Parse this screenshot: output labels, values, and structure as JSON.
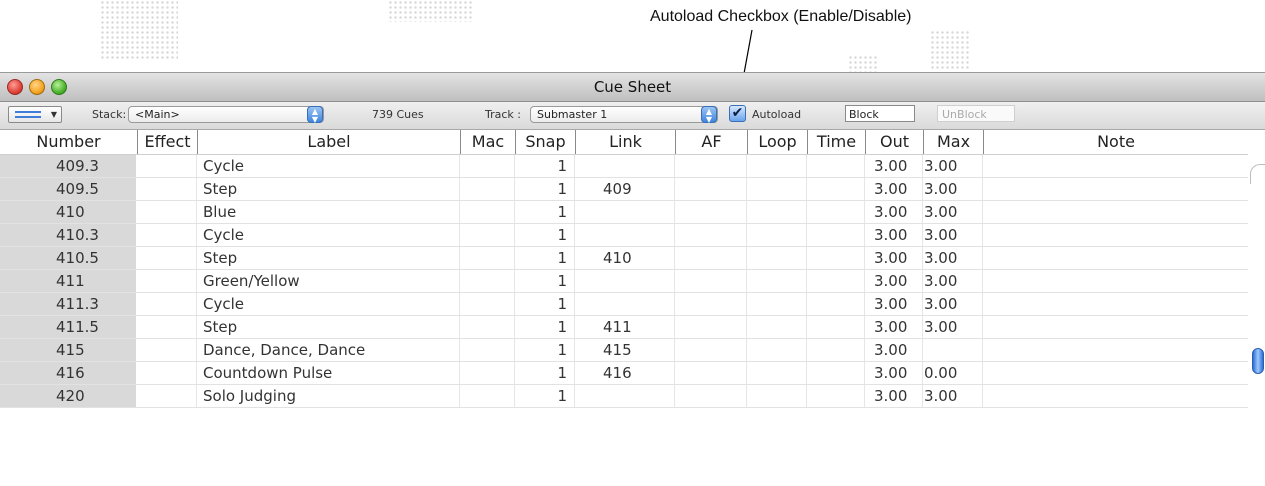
{
  "annotation": {
    "text": "Autoload Checkbox (Enable/Disable)"
  },
  "window": {
    "title": "Cue Sheet"
  },
  "toolbar": {
    "stack_label": "Stack:",
    "stack_value": "<Main>",
    "cue_count": "739 Cues",
    "track_label": "Track :",
    "track_value": "Submaster 1",
    "autoload_checked": true,
    "autoload_label": "Autoload",
    "block_label": "Block",
    "unblock_label": "UnBlock"
  },
  "table": {
    "columns": [
      "Number",
      "Effect",
      "Label",
      "Mac",
      "Snap",
      "Link",
      "AF",
      "Loop",
      "Time",
      "Out",
      "Max",
      "Note"
    ],
    "rows": [
      {
        "number": "409.3",
        "effect": "",
        "label": "Cycle",
        "mac": "",
        "snap": "1",
        "link": "",
        "af": "",
        "loop": "",
        "time": "",
        "out": "3.00",
        "max": "3.00",
        "note": ""
      },
      {
        "number": "409.5",
        "effect": "",
        "label": "Step",
        "mac": "",
        "snap": "1",
        "link": "409",
        "af": "",
        "loop": "",
        "time": "",
        "out": "3.00",
        "max": "3.00",
        "note": ""
      },
      {
        "number": "410",
        "effect": "",
        "label": "Blue",
        "mac": "",
        "snap": "1",
        "link": "",
        "af": "",
        "loop": "",
        "time": "",
        "out": "3.00",
        "max": "3.00",
        "note": ""
      },
      {
        "number": "410.3",
        "effect": "",
        "label": "Cycle",
        "mac": "",
        "snap": "1",
        "link": "",
        "af": "",
        "loop": "",
        "time": "",
        "out": "3.00",
        "max": "3.00",
        "note": ""
      },
      {
        "number": "410.5",
        "effect": "",
        "label": "Step",
        "mac": "",
        "snap": "1",
        "link": "410",
        "af": "",
        "loop": "",
        "time": "",
        "out": "3.00",
        "max": "3.00",
        "note": ""
      },
      {
        "number": "411",
        "effect": "",
        "label": "Green/Yellow",
        "mac": "",
        "snap": "1",
        "link": "",
        "af": "",
        "loop": "",
        "time": "",
        "out": "3.00",
        "max": "3.00",
        "note": ""
      },
      {
        "number": "411.3",
        "effect": "",
        "label": "Cycle",
        "mac": "",
        "snap": "1",
        "link": "",
        "af": "",
        "loop": "",
        "time": "",
        "out": "3.00",
        "max": "3.00",
        "note": ""
      },
      {
        "number": "411.5",
        "effect": "",
        "label": "Step",
        "mac": "",
        "snap": "1",
        "link": "411",
        "af": "",
        "loop": "",
        "time": "",
        "out": "3.00",
        "max": "3.00",
        "note": ""
      },
      {
        "number": "415",
        "effect": "",
        "label": "Dance, Dance, Dance",
        "mac": "",
        "snap": "1",
        "link": "415",
        "af": "",
        "loop": "",
        "time": "",
        "out": "3.00",
        "max": "",
        "note": ""
      },
      {
        "number": "416",
        "effect": "",
        "label": "Countdown Pulse",
        "mac": "",
        "snap": "1",
        "link": "416",
        "af": "",
        "loop": "",
        "time": "",
        "out": "3.00",
        "max": "0.00",
        "note": ""
      },
      {
        "number": "420",
        "effect": "",
        "label": "Solo Judging",
        "mac": "",
        "snap": "1",
        "link": "",
        "af": "",
        "loop": "",
        "time": "",
        "out": "3.00",
        "max": "3.00",
        "note": ""
      }
    ]
  },
  "colors": {
    "accent": "#3e7ed8",
    "number_column_bg": "#d9d9d9"
  }
}
